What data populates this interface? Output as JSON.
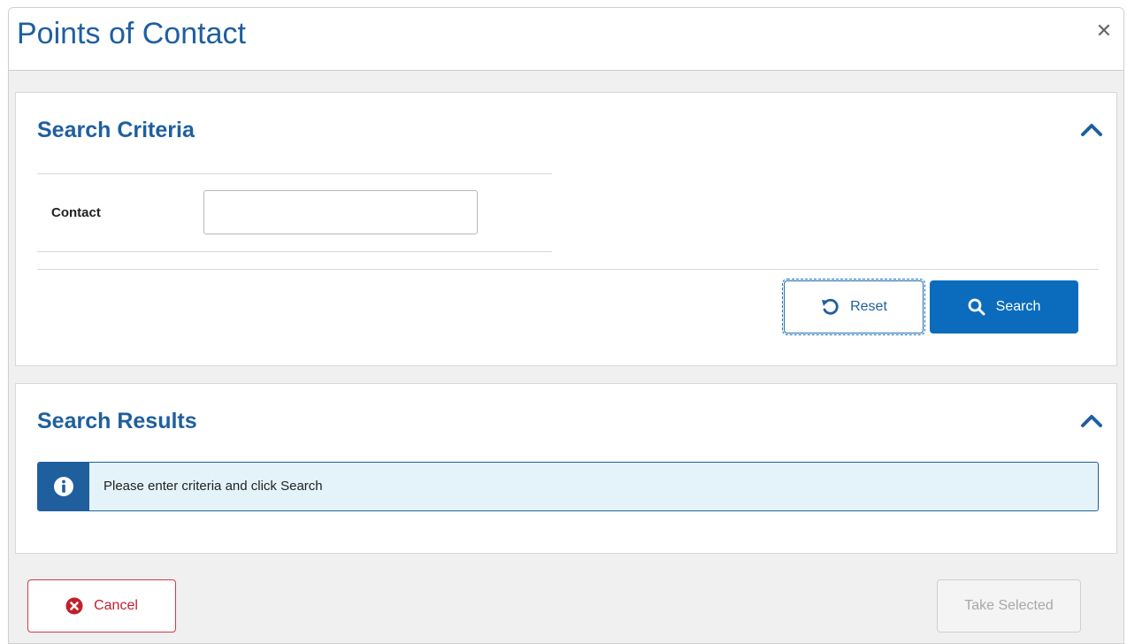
{
  "modal": {
    "title": "Points of Contact",
    "close_icon": "close-icon"
  },
  "search_criteria": {
    "title": "Search Criteria",
    "collapse_icon": "chevron-up-icon",
    "fields": [
      {
        "label": "Contact",
        "value": "",
        "placeholder": ""
      }
    ],
    "reset_label": "Reset",
    "reset_icon": "undo-icon",
    "search_label": "Search",
    "search_icon": "search-icon"
  },
  "search_results": {
    "title": "Search Results",
    "collapse_icon": "chevron-up-icon",
    "alert": {
      "icon": "info-icon",
      "message": "Please enter criteria and click Search"
    }
  },
  "footer": {
    "cancel_label": "Cancel",
    "cancel_icon": "times-circle-icon",
    "take_selected_label": "Take Selected",
    "take_selected_disabled": true
  },
  "colors": {
    "primary": "#0b6cbd",
    "heading": "#1f5f9e",
    "danger": "#c0222c",
    "info_bg": "#e4f3fa"
  }
}
